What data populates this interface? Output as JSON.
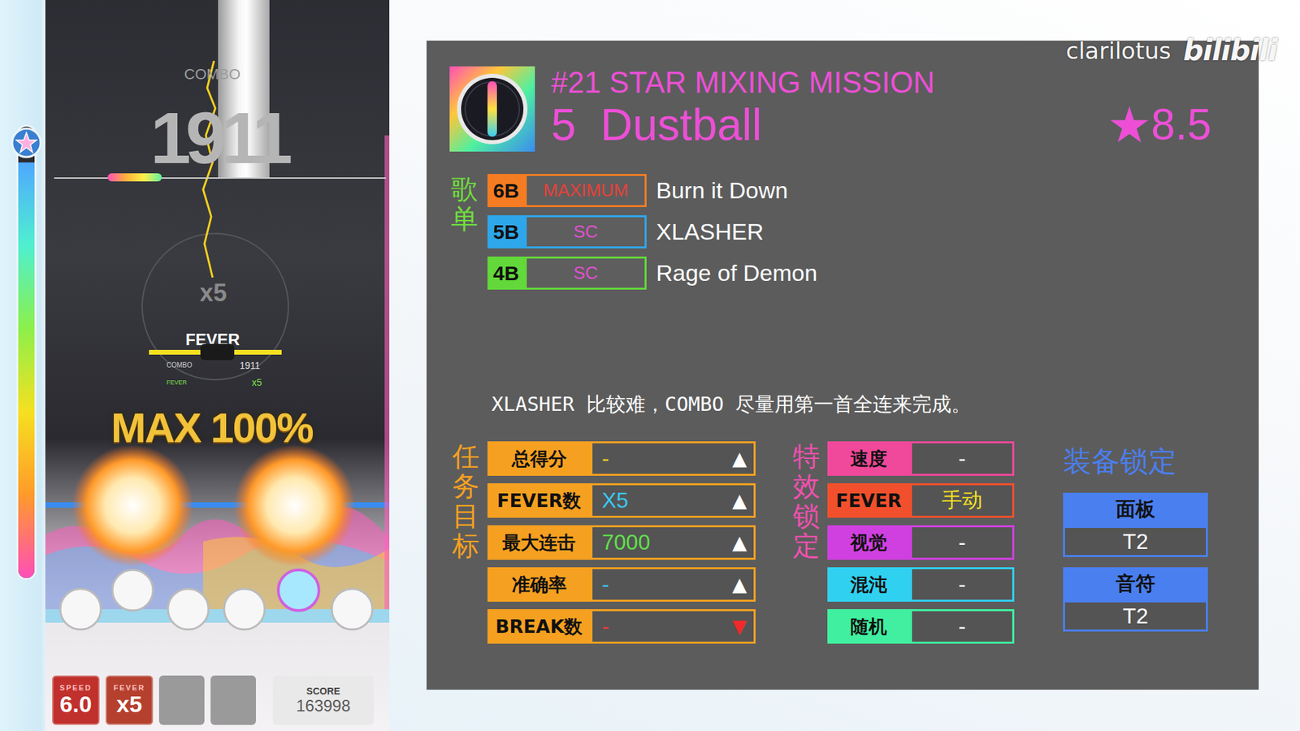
{
  "watermark": {
    "channel": "clarilotus",
    "site": "bilibili"
  },
  "game": {
    "combo_label": "COMBO",
    "combo": "1911",
    "fever_ring": "x5",
    "fever_label": "FEVER",
    "fever_bar": {
      "level": 1
    },
    "hud": {
      "combo_label": "COMBO",
      "combo": "1911",
      "fever_label": "FEVER",
      "fever": "x5"
    },
    "judgement": "MAX 100%",
    "fever_gauge": {
      "level": 0.92
    },
    "status": [
      {
        "label": "SPEED",
        "value": "6.0",
        "color": "#c0302c"
      },
      {
        "label": "FEVER",
        "value": "x5",
        "color": "#b5402e"
      }
    ],
    "score": {
      "label": "SCORE",
      "value": "163998"
    }
  },
  "mission": {
    "number": "#21 STAR MIXING MISSION",
    "stage": "5",
    "title": "Dustball",
    "level": "★8.5"
  },
  "playlist": {
    "label": "歌单",
    "songs": [
      {
        "button": "6B",
        "color": "#f57c22",
        "difficulty": "MAXIMUM",
        "difficulty_color": "#e8413a",
        "title": "Burn it Down"
      },
      {
        "button": "5B",
        "color": "#2ea6ea",
        "difficulty": "SC",
        "difficulty_color": "#e050d0",
        "title": "XLASHER"
      },
      {
        "button": "4B",
        "color": "#62d83a",
        "difficulty": "SC",
        "difficulty_color": "#e050d0",
        "title": "Rage of Demon"
      }
    ]
  },
  "note": "XLASHER 比较难，COMBO 尽量用第一首全连来完成。",
  "objectives": {
    "label": "任务目标",
    "items": [
      {
        "label": "总得分",
        "value": "-",
        "value_color": "#f5d020",
        "arrow": "▲",
        "arrow_color": "#ffffff"
      },
      {
        "label": "FEVER数",
        "value": "X5",
        "value_color": "#38c8f0",
        "arrow": "▲",
        "arrow_color": "#ffffff"
      },
      {
        "label": "最大连击",
        "value": "7000",
        "value_color": "#5fe04a",
        "arrow": "▲",
        "arrow_color": "#ffffff"
      },
      {
        "label": "准确率",
        "value": "-",
        "value_color": "#38c8f0",
        "arrow": "▲",
        "arrow_color": "#ffffff"
      },
      {
        "label": "BREAK数",
        "value": "-",
        "value_color": "#f03a3a",
        "arrow": "▼",
        "arrow_color": "#f02a2a"
      }
    ]
  },
  "effects": {
    "label": "特效锁定",
    "items": [
      {
        "label": "速度",
        "value": "-",
        "color": "#f0489a",
        "value_color": "#ffffff"
      },
      {
        "label": "FEVER",
        "value": "手动",
        "color": "#f2502c",
        "value_color": "#f5e020"
      },
      {
        "label": "视觉",
        "value": "-",
        "color": "#d040e0",
        "value_color": "#ffffff"
      },
      {
        "label": "混沌",
        "value": "-",
        "color": "#30d0f0",
        "value_color": "#ffffff"
      },
      {
        "label": "随机",
        "value": "-",
        "color": "#40f0a0",
        "value_color": "#ffffff"
      }
    ]
  },
  "equipment": {
    "label": "装备锁定",
    "items": [
      {
        "label": "面板",
        "value": "T2"
      },
      {
        "label": "音符",
        "value": "T2"
      }
    ]
  }
}
